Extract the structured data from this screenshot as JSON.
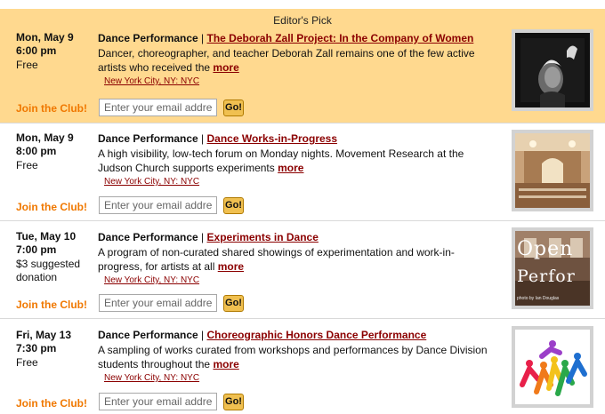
{
  "editors_pick_label": "Editor's Pick",
  "join_label": "Join the Club!",
  "email_placeholder": "Enter your email address",
  "go_label": "Go!",
  "more_label": "more",
  "events": [
    {
      "date": "Mon, May 9",
      "time": "6:00 pm",
      "price": "Free",
      "category": "Dance Performance",
      "title": "The Deborah Zall Project: In the Company of Women",
      "description": "Dancer, choreographer, and teacher Deborah Zall remains one of the few active artists who received the",
      "location": "New York City, NY: NYC",
      "image": "dancer-portrait-photo"
    },
    {
      "date": "Mon, May 9",
      "time": "8:00 pm",
      "price": "Free",
      "category": "Dance Performance",
      "title": "Dance Works-in-Progress",
      "description": "A high visibility, low-tech forum on Monday nights. Movement Research at the Judson Church supports experiments",
      "location": "New York City, NY: NYC",
      "image": "church-interior-photo"
    },
    {
      "date": "Tue, May 10",
      "time": "7:00 pm",
      "price": "$3 suggested donation",
      "category": "Dance Performance",
      "title": "Experiments in Dance",
      "description": "A program of non-curated shared showings of experimentation and work-in-progress, for artists at all",
      "location": "New York City, NY: NYC",
      "image": "open-performance-poster",
      "image_text_1": "Open",
      "image_text_2": "Perfor",
      "image_credit": "photo by Ian Douglas"
    },
    {
      "date": "Fri, May 13",
      "time": "7:30 pm",
      "price": "Free",
      "category": "Dance Performance",
      "title": "Choreographic Honors Dance Performance",
      "description": "A sampling of works curated from workshops and performances by Dance Division students throughout the",
      "location": "New York City, NY: NYC",
      "image": "colorful-dancers-graphic"
    }
  ],
  "colors": {
    "pick_background": "#ffd98f",
    "link": "#8b0000",
    "join": "#f07800",
    "go_button": "#f0c050"
  }
}
